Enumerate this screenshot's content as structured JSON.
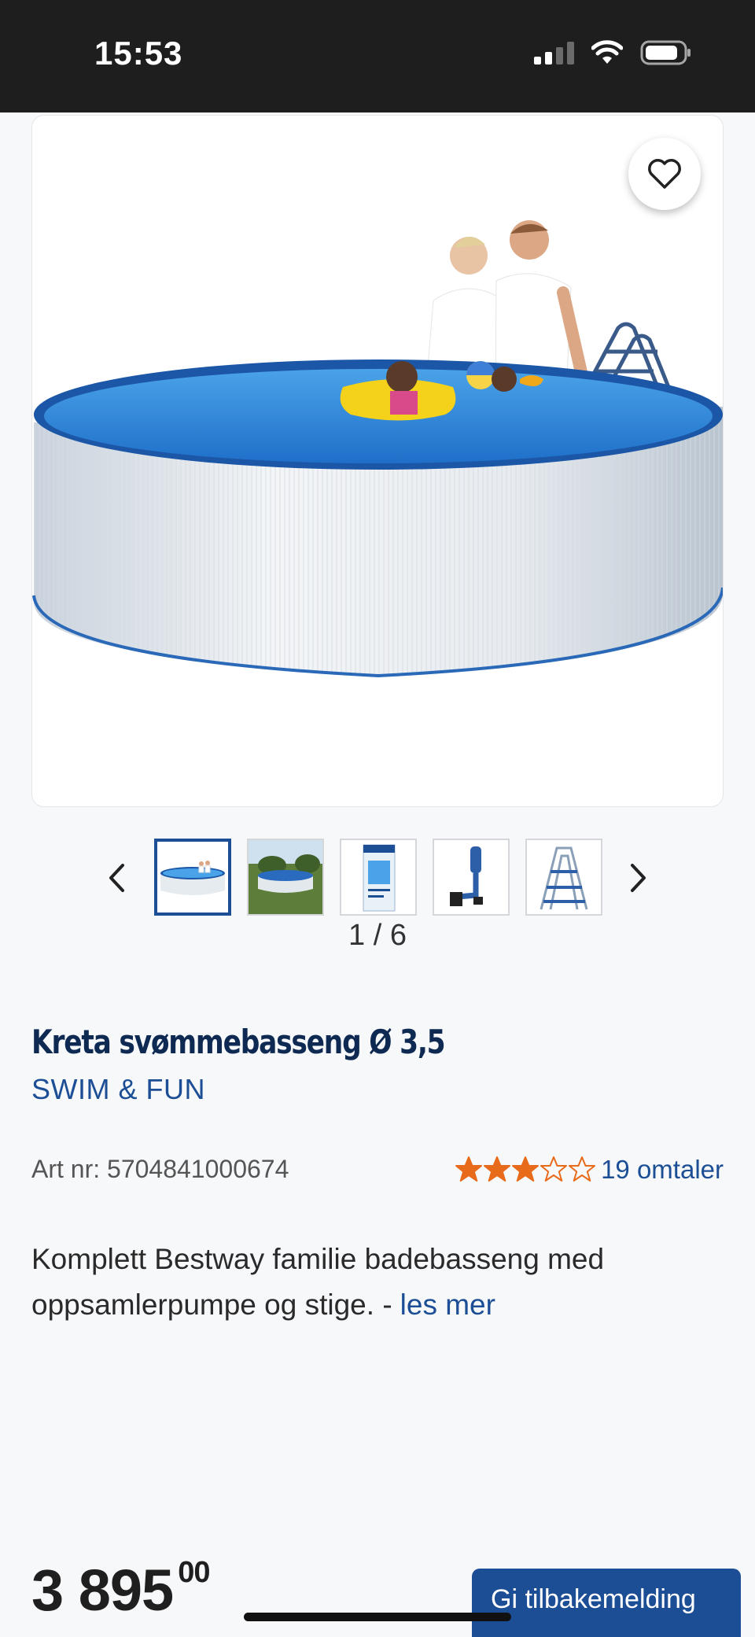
{
  "status_bar": {
    "time": "15:53"
  },
  "product": {
    "title": "Kreta svømmebasseng Ø 3,5",
    "brand": "SWIM & FUN",
    "art_nr": "Art nr: 5704841000674",
    "rating": {
      "value": 3,
      "max": 5,
      "reviews_label": "19 omtaler"
    },
    "description": "Komplett Bestway familie badebasseng med oppsamlerpumpe og stige. -",
    "read_more": "les mer"
  },
  "gallery": {
    "counter": "1 / 6",
    "thumbnails": [
      "pool-white",
      "pool-garden",
      "pump-box",
      "skimmer",
      "ladder"
    ]
  },
  "price": {
    "integer": "3 895",
    "decimals": "00"
  },
  "actions": {
    "notify_label": "Gi tilbakemelding"
  },
  "colors": {
    "primary": "#1c4e95",
    "title": "#0e2a52",
    "star": "#e86a1b",
    "statusbar": "#1e1e1e"
  }
}
